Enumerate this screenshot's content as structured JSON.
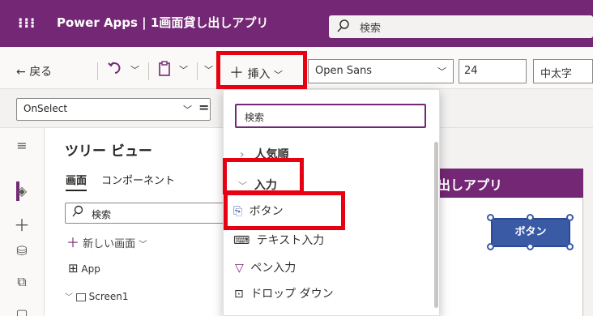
{
  "app": {
    "waffle": "⁝⁝⁝",
    "title": "Power Apps | 1画面貸し出しアプリ",
    "search_placeholder": "検索"
  },
  "toolbar": {
    "back_label": "戻る",
    "undo_icon": "undo-icon",
    "paste_icon": "paste-icon",
    "insert_label": "挿入",
    "font_family": "Open Sans",
    "font_size": "24",
    "font_weight": "中太字"
  },
  "formula": {
    "property": "OnSelect",
    "equals": "="
  },
  "tree": {
    "title": "ツリー ビュー",
    "tabs": [
      "画面",
      "コンポーネント"
    ],
    "search_placeholder": "検索",
    "new_screen": "新しい画面",
    "nodes": [
      "App",
      "Screen1"
    ]
  },
  "canvas": {
    "screen_title": "出しアプリ",
    "button_label": "ボタン"
  },
  "insert_menu": {
    "search_placeholder": "検索",
    "groups": [
      {
        "label": "人気順",
        "expanded": false
      },
      {
        "label": "入力",
        "expanded": true
      }
    ],
    "items": [
      {
        "label": "ボタン",
        "icon": "button-icon"
      },
      {
        "label": "テキスト入力",
        "icon": "text-input-icon"
      },
      {
        "label": "ペン入力",
        "icon": "pen-input-icon"
      },
      {
        "label": "ドロップ ダウン",
        "icon": "dropdown-icon"
      }
    ]
  },
  "colors": {
    "brand": "#742774",
    "highlight": "#e60012",
    "button": "#3a5aa6"
  }
}
